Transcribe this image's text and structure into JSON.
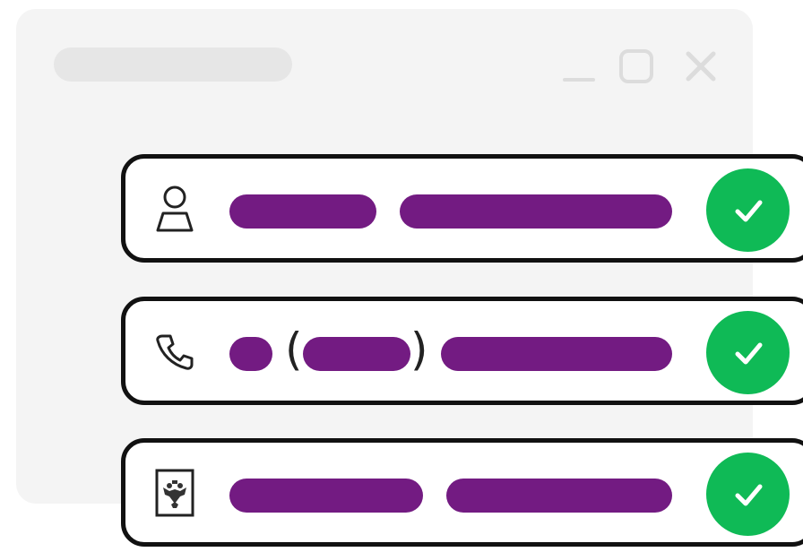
{
  "window": {
    "title": "",
    "controls": [
      "minimize-icon",
      "maximize-icon",
      "close-icon"
    ]
  },
  "fields": [
    {
      "name": "full-name",
      "icon": "person-icon",
      "status": "verified"
    },
    {
      "name": "phone-number",
      "icon": "phone-icon",
      "status": "verified",
      "open_paren": "(",
      "close_paren": ")"
    },
    {
      "name": "government-id",
      "icon": "coat-of-arms-icon",
      "status": "verified"
    }
  ],
  "colors": {
    "window_bg": "#f4f4f4",
    "placeholder": "#731b82",
    "verified": "#0fba56",
    "border": "#111111"
  }
}
